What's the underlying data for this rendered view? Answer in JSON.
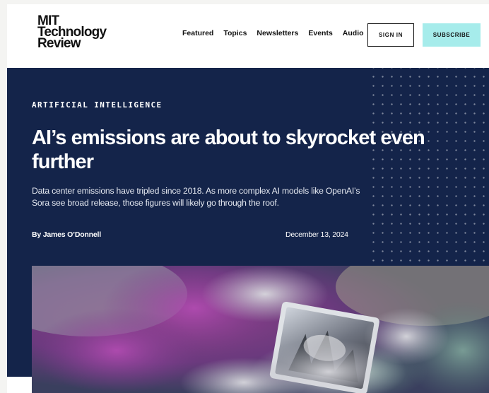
{
  "header": {
    "logo_lines": [
      "MIT",
      "Technology",
      "Review"
    ],
    "nav": [
      "Featured",
      "Topics",
      "Newsletters",
      "Events",
      "Audio"
    ],
    "signin_label": "SIGN IN",
    "subscribe_label": "SUBSCRIBE"
  },
  "article": {
    "kicker": "ARTIFICIAL INTELLIGENCE",
    "headline": "AI’s emissions are about to skyrocket even further",
    "dek": "Data center emissions have tripled since 2018. As more complex AI models like OpenAI’s Sora see broad release, those figures will likely go through the roof.",
    "byline": "By James O’Donnell",
    "date": "December 13, 2024"
  },
  "colors": {
    "hero_bg": "#14244a",
    "subscribe_bg": "#a6eceb"
  },
  "icons": [
    "laptop-in-smoke-illustration"
  ]
}
